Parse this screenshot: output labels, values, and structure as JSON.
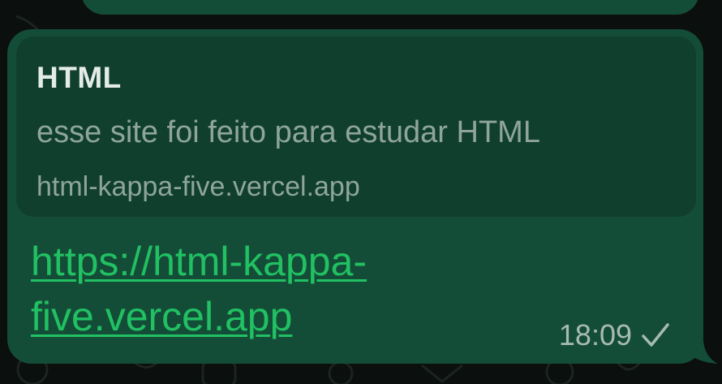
{
  "link_preview": {
    "title": "HTML",
    "description": "esse site foi feito para estudar HTML",
    "domain": "html-kappa-five.vercel.app"
  },
  "message": {
    "link_line1": "https://html-kappa-",
    "link_line2": "five.vercel.app",
    "time": "18:09",
    "status_icon": "single-check-icon"
  },
  "colors": {
    "background": "#0b0f0e",
    "bubble": "#144d37",
    "preview_card": "#103f2d",
    "link": "#21c063",
    "meta_text": "#a7bbb2"
  }
}
